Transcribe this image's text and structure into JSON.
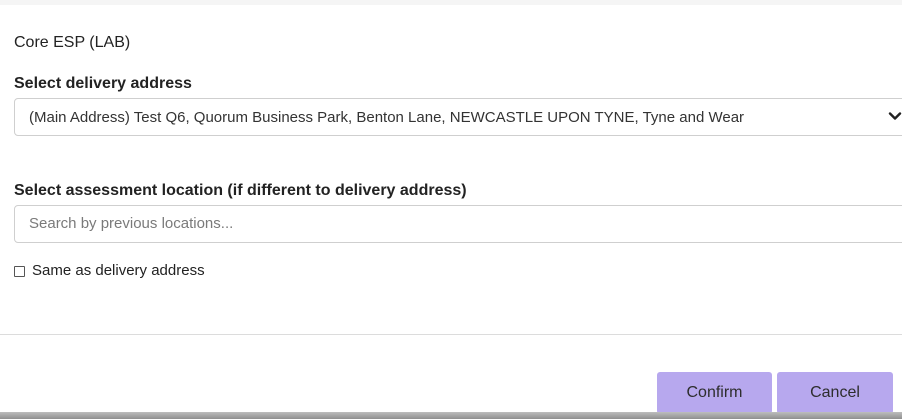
{
  "dialog": {
    "title": "Core ESP (LAB)",
    "delivery": {
      "label": "Select delivery address",
      "selected_value": "(Main Address) Test Q6, Quorum Business Park, Benton Lane, NEWCASTLE UPON TYNE, Tyne and Wear",
      "icon": "chevron-down-icon"
    },
    "assessment": {
      "label": "Select assessment location (if different to delivery address)",
      "search_placeholder": "Search by previous locations...",
      "search_value": ""
    },
    "same_as_delivery": {
      "label": "Same as delivery address",
      "checked": false
    },
    "buttons": {
      "confirm": "Confirm",
      "cancel": "Cancel"
    },
    "colors": {
      "button_background": "#b7a8ee",
      "text": "#222222",
      "border": "#cfcfcf"
    }
  }
}
